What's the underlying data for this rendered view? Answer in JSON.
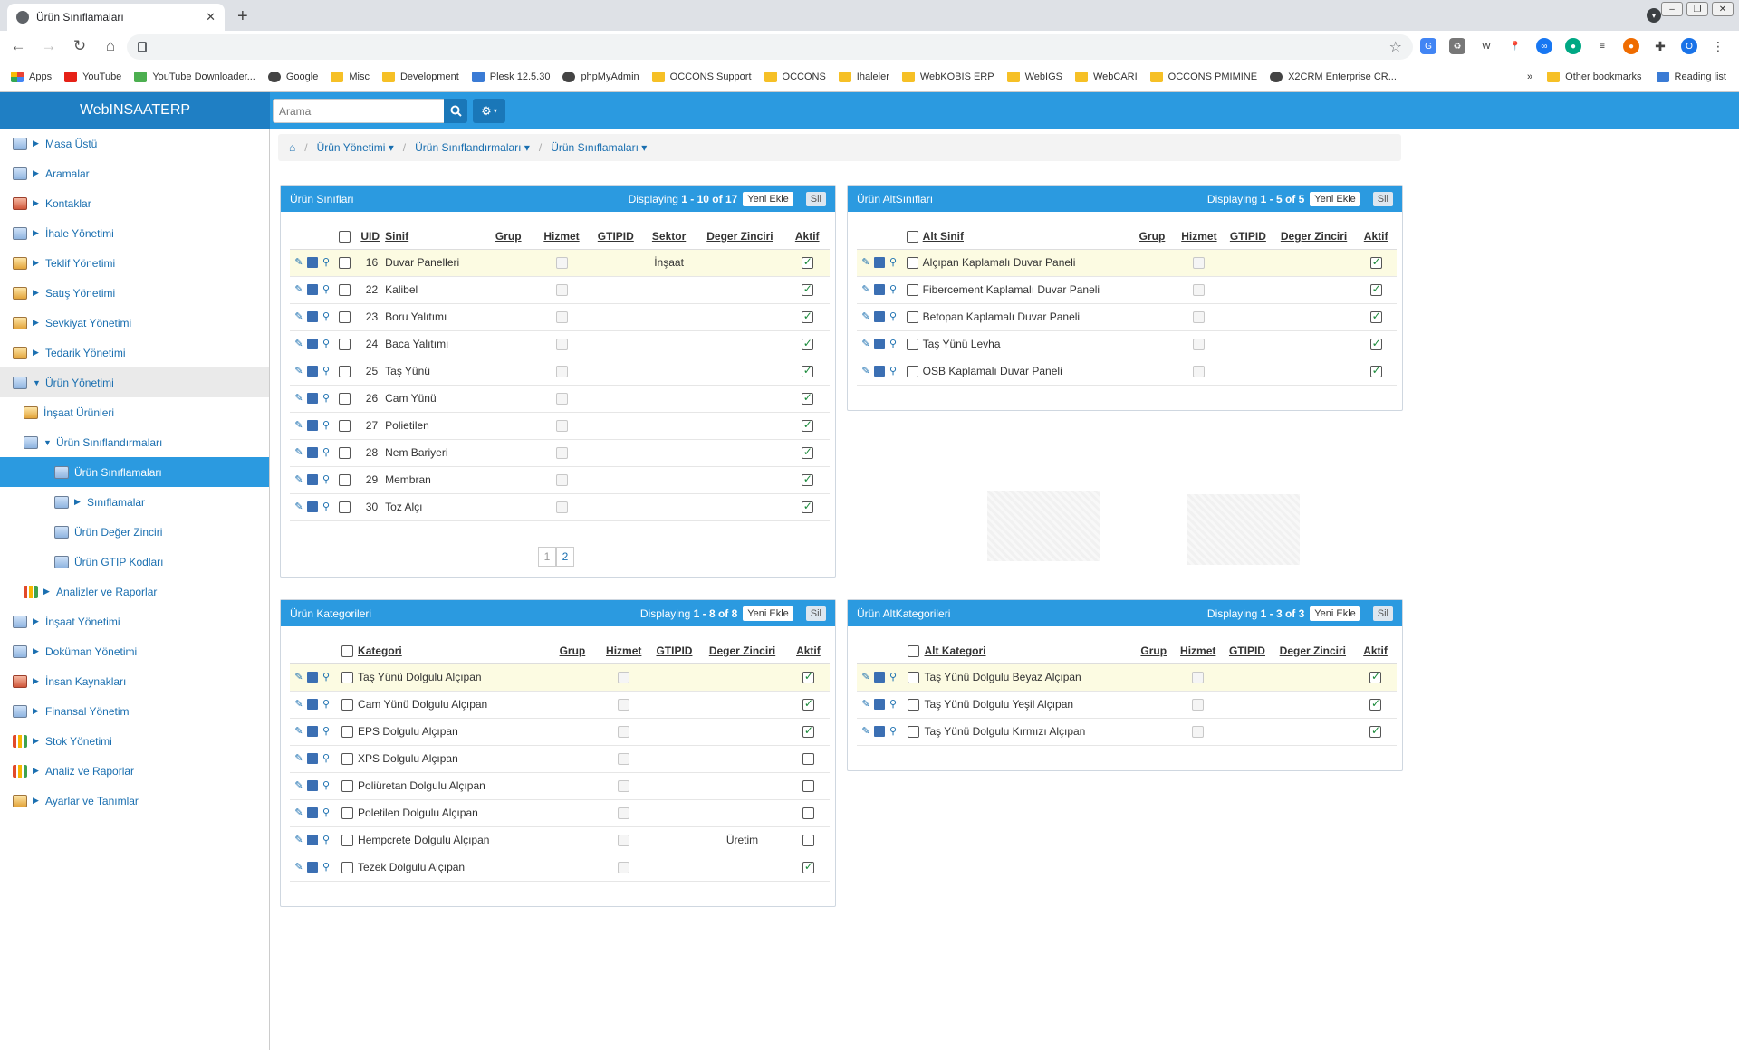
{
  "browser": {
    "tab_title": "Ürün Sınıflamaları",
    "bookmarks": [
      "Apps",
      "YouTube",
      "YouTube Downloader...",
      "Google",
      "Misc",
      "Development",
      "Plesk 12.5.30",
      "phpMyAdmin",
      "OCCONS Support",
      "OCCONS",
      "Ihaleler",
      "WebKOBIS ERP",
      "WebIGS",
      "WebCARI",
      "OCCONS PMIMINE",
      "X2CRM Enterprise CR..."
    ],
    "bookmarks_more": "»",
    "other_bookmarks": "Other bookmarks",
    "reading_list": "Reading list",
    "profile_initial": "O"
  },
  "app": {
    "brand": "WebINSAATERP",
    "search_placeholder": "Arama"
  },
  "sidebar": [
    {
      "label": "Masa Üstü",
      "level": 0
    },
    {
      "label": "Aramalar",
      "level": 0
    },
    {
      "label": "Kontaklar",
      "level": 0
    },
    {
      "label": "İhale Yönetimi",
      "level": 0
    },
    {
      "label": "Teklif Yönetimi",
      "level": 0
    },
    {
      "label": "Satış Yönetimi",
      "level": 0
    },
    {
      "label": "Sevkiyat Yönetimi",
      "level": 0
    },
    {
      "label": "Tedarik Yönetimi",
      "level": 0
    },
    {
      "label": "Ürün Yönetimi",
      "level": 0
    },
    {
      "label": "İnşaat Ürünleri",
      "level": 1
    },
    {
      "label": "Ürün Sınıflandırmaları",
      "level": 1
    },
    {
      "label": "Ürün Sınıflamaları",
      "level": 2
    },
    {
      "label": "Sınıflamalar",
      "level": 2
    },
    {
      "label": "Ürün Değer Zinciri",
      "level": 2
    },
    {
      "label": "Ürün GTIP Kodları",
      "level": 2
    },
    {
      "label": "Analizler ve Raporlar",
      "level": 1
    },
    {
      "label": "İnşaat Yönetimi",
      "level": 0
    },
    {
      "label": "Doküman Yönetimi",
      "level": 0
    },
    {
      "label": "İnsan Kaynakları",
      "level": 0
    },
    {
      "label": "Finansal Yönetim",
      "level": 0
    },
    {
      "label": "Stok Yönetimi",
      "level": 0
    },
    {
      "label": "Analiz ve Raporlar",
      "level": 0
    },
    {
      "label": "Ayarlar ve Tanımlar",
      "level": 0
    }
  ],
  "breadcrumb": [
    "Ürün Yönetimi",
    "Ürün Sınıflandırmaları",
    "Ürün Sınıflamaları"
  ],
  "common": {
    "add_label": "Yeni Ekle",
    "delete_label": "Sil",
    "displaying": "Displaying"
  },
  "siniflar": {
    "title": "Ürün Sınıfları",
    "range": "1 - 10 of 17",
    "columns": [
      "UID",
      "Sinif",
      "Grup",
      "Hizmet",
      "GTIPID",
      "Sektor",
      "Deger Zinciri",
      "Aktif"
    ],
    "rows": [
      {
        "uid": "16",
        "name": "Duvar Panelleri",
        "sektor": "İnşaat",
        "aktif": true
      },
      {
        "uid": "22",
        "name": "Kalibel",
        "sektor": "",
        "aktif": true
      },
      {
        "uid": "23",
        "name": "Boru Yalıtımı",
        "sektor": "",
        "aktif": true
      },
      {
        "uid": "24",
        "name": "Baca Yalıtımı",
        "sektor": "",
        "aktif": true
      },
      {
        "uid": "25",
        "name": "Taş Yünü",
        "sektor": "",
        "aktif": true
      },
      {
        "uid": "26",
        "name": "Cam Yünü",
        "sektor": "",
        "aktif": true
      },
      {
        "uid": "27",
        "name": "Polietilen",
        "sektor": "",
        "aktif": true
      },
      {
        "uid": "28",
        "name": "Nem Bariyeri",
        "sektor": "",
        "aktif": true
      },
      {
        "uid": "29",
        "name": "Membran",
        "sektor": "",
        "aktif": true
      },
      {
        "uid": "30",
        "name": "Toz Alçı",
        "sektor": "",
        "aktif": true
      }
    ],
    "pages": [
      "1",
      "2"
    ]
  },
  "altsiniflar": {
    "title": "Ürün AltSınıfları",
    "range": "1 - 5 of 5",
    "columns": [
      "Alt Sinif",
      "Grup",
      "Hizmet",
      "GTIPID",
      "Deger Zinciri",
      "Aktif"
    ],
    "rows": [
      {
        "name": "Alçıpan Kaplamalı Duvar Paneli",
        "aktif": true
      },
      {
        "name": "Fibercement Kaplamalı Duvar Paneli",
        "aktif": true
      },
      {
        "name": "Betopan Kaplamalı Duvar Paneli",
        "aktif": true
      },
      {
        "name": "Taş Yünü Levha",
        "aktif": true
      },
      {
        "name": "OSB Kaplamalı Duvar Paneli",
        "aktif": true
      }
    ]
  },
  "kategoriler": {
    "title": "Ürün Kategorileri",
    "range": "1 - 8 of 8",
    "columns": [
      "Kategori",
      "Grup",
      "Hizmet",
      "GTIPID",
      "Deger Zinciri",
      "Aktif"
    ],
    "rows": [
      {
        "name": "Taş Yünü Dolgulu Alçıpan",
        "deger": "",
        "aktif": true
      },
      {
        "name": "Cam Yünü Dolgulu Alçıpan",
        "deger": "",
        "aktif": true
      },
      {
        "name": "EPS Dolgulu Alçıpan",
        "deger": "",
        "aktif": true
      },
      {
        "name": "XPS Dolgulu Alçıpan",
        "deger": "",
        "aktif": false
      },
      {
        "name": "Poliüretan Dolgulu Alçıpan",
        "deger": "",
        "aktif": false
      },
      {
        "name": "Poletilen Dolgulu Alçıpan",
        "deger": "",
        "aktif": false
      },
      {
        "name": "Hempcrete Dolgulu Alçıpan",
        "deger": "Üretim",
        "aktif": false
      },
      {
        "name": "Tezek Dolgulu Alçıpan",
        "deger": "",
        "aktif": true
      }
    ]
  },
  "altkategoriler": {
    "title": "Ürün AltKategorileri",
    "range": "1 - 3 of 3",
    "columns": [
      "Alt Kategori",
      "Grup",
      "Hizmet",
      "GTIPID",
      "Deger Zinciri",
      "Aktif"
    ],
    "rows": [
      {
        "name": "Taş Yünü Dolgulu Beyaz Alçıpan",
        "aktif": true
      },
      {
        "name": "Taş Yünü Dolgulu Yeşil Alçıpan",
        "aktif": true
      },
      {
        "name": "Taş Yünü Dolgulu Kırmızı Alçıpan",
        "aktif": true
      }
    ]
  }
}
